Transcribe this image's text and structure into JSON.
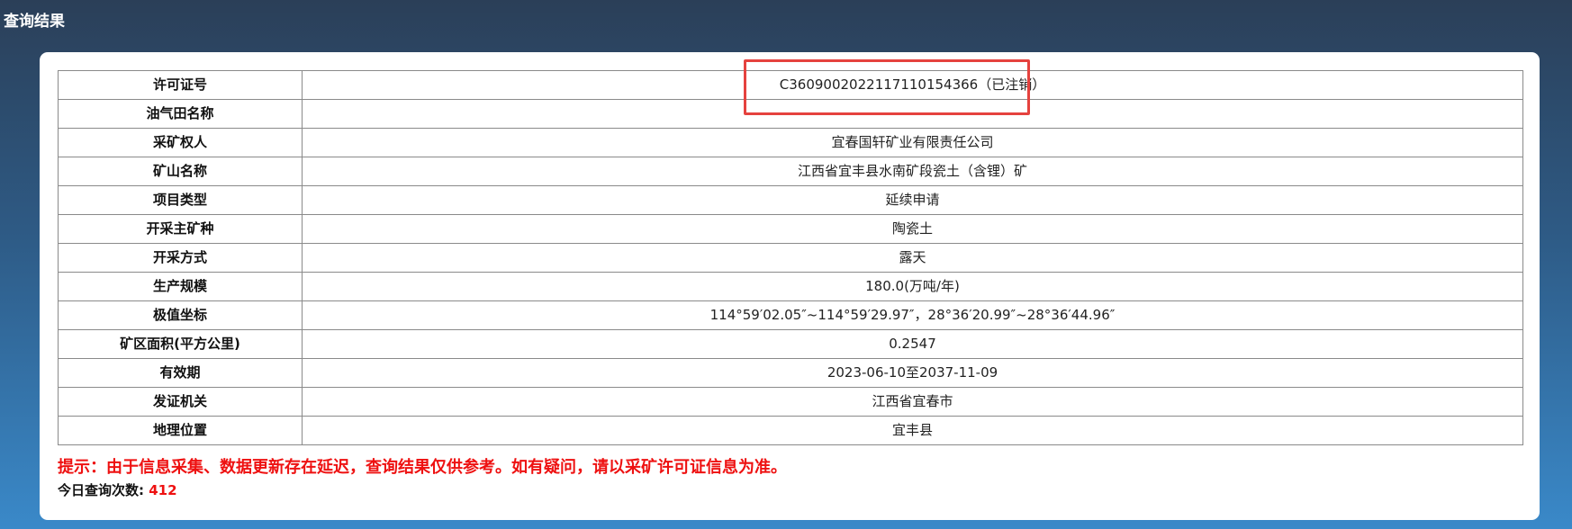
{
  "header": {
    "title": "查询结果"
  },
  "rows": [
    {
      "label": "许可证号",
      "value": "C3609002022117110154366（已注销）"
    },
    {
      "label": "油气田名称",
      "value": ""
    },
    {
      "label": "采矿权人",
      "value": "宜春国轩矿业有限责任公司"
    },
    {
      "label": "矿山名称",
      "value": "江西省宜丰县水南矿段瓷土（含锂）矿"
    },
    {
      "label": "项目类型",
      "value": "延续申请"
    },
    {
      "label": "开采主矿种",
      "value": "陶瓷土"
    },
    {
      "label": "开采方式",
      "value": "露天"
    },
    {
      "label": "生产规模",
      "value": "180.0(万吨/年)"
    },
    {
      "label": "极值坐标",
      "value": "114°59′02.05″~114°59′29.97″，28°36′20.99″~28°36′44.96″"
    },
    {
      "label": "矿区面积(平方公里)",
      "value": "0.2547"
    },
    {
      "label": "有效期",
      "value": "2023-06-10至2037-11-09"
    },
    {
      "label": "发证机关",
      "value": "江西省宜春市"
    },
    {
      "label": "地理位置",
      "value": "宜丰县"
    }
  ],
  "notice": "提示：由于信息采集、数据更新存在延迟，查询结果仅供参考。如有疑问，请以采矿许可证信息为准。",
  "counter": {
    "label": "今日查询次数:",
    "value": "412"
  },
  "colors": {
    "accent_red": "#e0201a",
    "highlight_border": "#e5423e",
    "notice_red": "#ee1111",
    "background_top": "#2b3f58",
    "background_bottom": "#3a89c9"
  }
}
